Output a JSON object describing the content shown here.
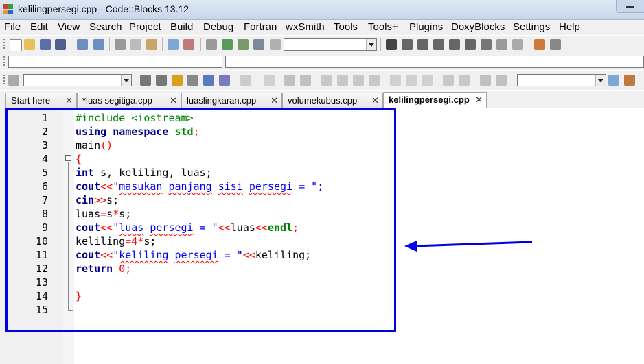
{
  "window": {
    "title": "kelilingpersegi.cpp - Code::Blocks 13.12"
  },
  "menu": [
    "File",
    "Edit",
    "View",
    "Search",
    "Project",
    "Build",
    "Debug",
    "Fortran",
    "wxSmith",
    "Tools",
    "Tools+",
    "Plugins",
    "DoxyBlocks",
    "Settings",
    "Help"
  ],
  "tabs": [
    {
      "label": "Start here",
      "active": false
    },
    {
      "label": "*luas segitiga.cpp",
      "active": false
    },
    {
      "label": "luaslingkaran.cpp",
      "active": false
    },
    {
      "label": "volumekubus.cpp",
      "active": false
    },
    {
      "label": "kelilingpersegi.cpp",
      "active": true
    }
  ],
  "editor": {
    "line_numbers": [
      "1",
      "2",
      "3",
      "4",
      "5",
      "6",
      "7",
      "8",
      "9",
      "10",
      "11",
      "12",
      "13",
      "14",
      "15"
    ],
    "code": {
      "l1": "#include <iostream>",
      "l2_kw1": "using",
      "l2_kw2": "namespace",
      "l2_std": "std",
      "l2_semi": ";",
      "l3_a": "main",
      "l3_b": "()",
      "l4": "{",
      "l5_kw": "int",
      "l5_rest": " s, keliling, luas;",
      "l6_a": "cout",
      "l6_op": "<<",
      "l6_q": "\"",
      "l6_w1": "masukan",
      "l6_w2": "panjang",
      "l6_w3": "sisi",
      "l6_w4": "persegi",
      "l6_end": " = \";",
      "l7_a": "cin",
      "l7_op": ">>",
      "l7_rest": "s;",
      "l8_a": "luas",
      "l8_op1": "=",
      "l8_b": "s",
      "l8_op2": "*",
      "l8_c": "s;",
      "l9_a": "cout",
      "l9_op": "<<",
      "l9_q": "\"",
      "l9_w1": "luas",
      "l9_w2": "persegi",
      "l9_s": " = \"",
      "l9_op2": "<<",
      "l9_v": "luas",
      "l9_op3": "<<",
      "l9_endl": "endl",
      "l9_semi": ";",
      "l10_a": "keliling",
      "l10_op1": "=",
      "l10_n": "4",
      "l10_op2": "*",
      "l10_b": "s;",
      "l11_a": "cout",
      "l11_op": "<<",
      "l11_q": "\"",
      "l11_w1": "keliling",
      "l11_w2": "persegi",
      "l11_s": " = \"",
      "l11_op2": "<<",
      "l11_v": "keliling;",
      "l12_kw": "return",
      "l12_n": "0",
      "l12_semi": ";",
      "l14": "}"
    }
  },
  "annotation": {
    "box_color": "#0000e6",
    "arrow_color": "#0000e6"
  }
}
